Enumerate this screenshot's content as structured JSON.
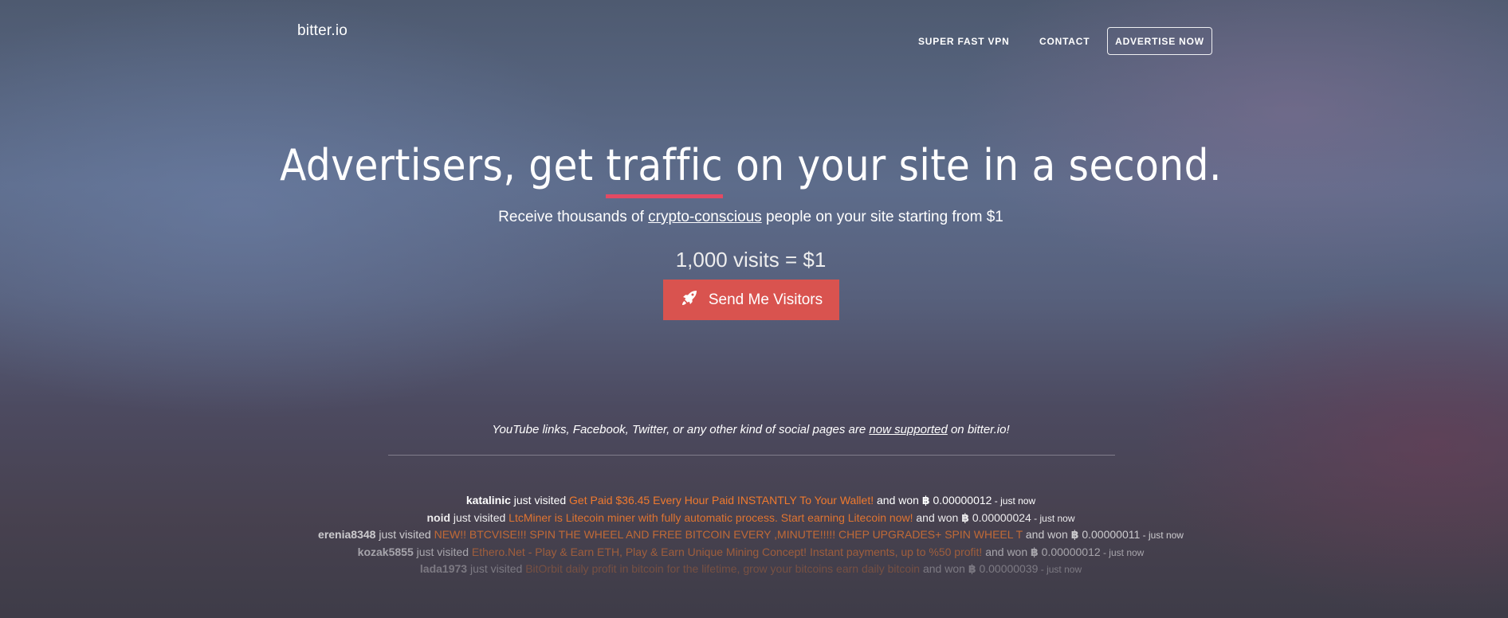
{
  "nav": {
    "logo": "bitter.io",
    "links": [
      "SUPER FAST VPN",
      "CONTACT"
    ],
    "cta_label": "ADVERTISE NOW"
  },
  "hero": {
    "title_before": "Advertisers, get ",
    "title_accent": "traffic",
    "title_after": " on your site in a second.",
    "accent_color": "#e34a63",
    "subtitle_before": "Receive thousands of ",
    "subtitle_link": "crypto-conscious",
    "subtitle_after": " people on your site starting from $1",
    "price": "1,000 visits = $1",
    "cta_label": "Send Me Visitors",
    "cta_icon": "rocket-icon",
    "cta_color": "#d9534f"
  },
  "notice": {
    "before": "YouTube links, Facebook, Twitter, or any other kind of social pages are ",
    "link": "now supported",
    "after": " on bitter.io!"
  },
  "feed": {
    "visited_label": " just visited ",
    "won_label": " and won ",
    "currency_symbol": "฿",
    "link_color": "#f07a2e",
    "items": [
      {
        "user": "katalinic",
        "site": "Get Paid $36.45 Every Hour Paid INSTANTLY To Your Wallet!",
        "amount": "0.00000012",
        "when": " - just now"
      },
      {
        "user": "noid",
        "site": "LtcMiner is Litecoin miner with fully automatic process. Start earning Litecoin now!",
        "amount": "0.00000024",
        "when": " - just now"
      },
      {
        "user": "erenia8348",
        "site": "NEW!! BTCVISE!!! SPIN THE WHEEL AND FREE BITCOIN EVERY ,MINUTE!!!!! CHEP UPGRADES+ SPIN WHEEL T",
        "amount": "0.00000011",
        "when": " - just now"
      },
      {
        "user": "kozak5855",
        "site": "Ethero.Net - Play & Earn ETH, Play & Earn Unique Mining Concept! Instant payments, up to %50 profit!",
        "amount": "0.00000012",
        "when": " - just now"
      },
      {
        "user": "lada1973",
        "site": "BitOrbit daily profit in bitcoin for the lifetime, grow your bitcoins earn daily bitcoin",
        "amount": "0.00000039",
        "when": " - just now"
      }
    ]
  }
}
